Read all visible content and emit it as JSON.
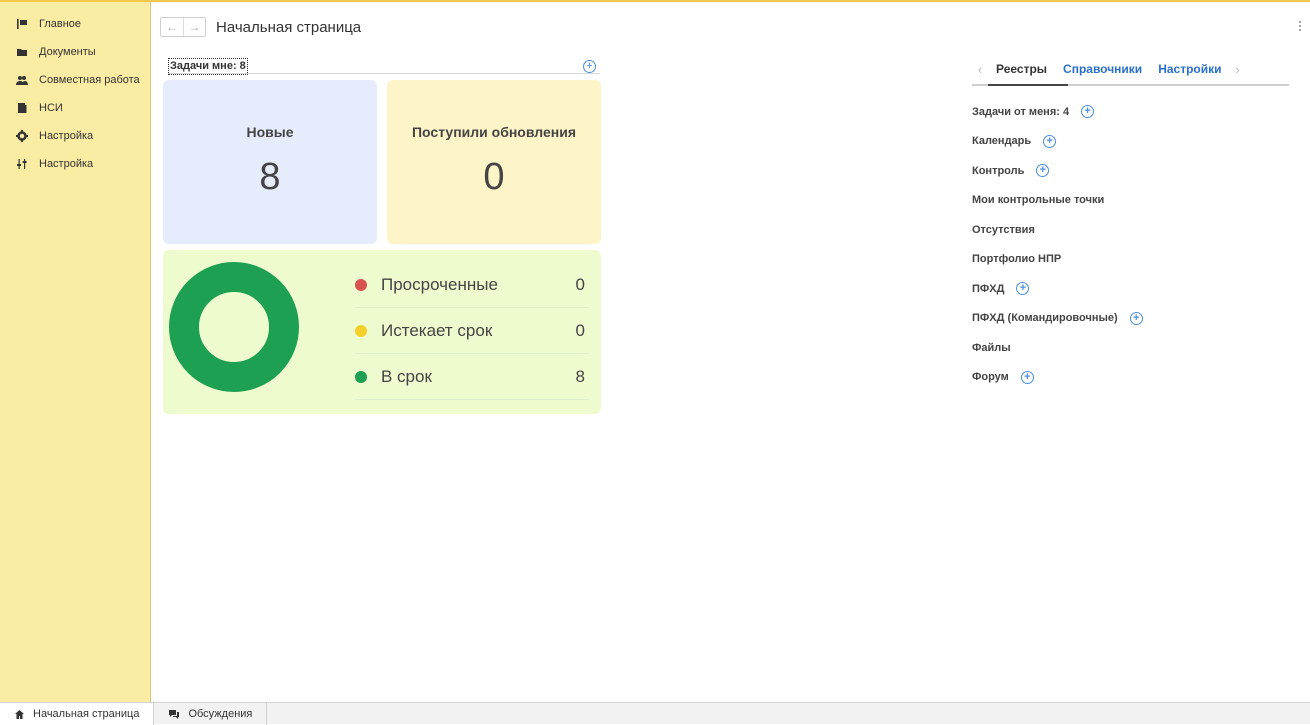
{
  "sidebar": {
    "items": [
      {
        "label": "Главное",
        "icon": "flag-icon"
      },
      {
        "label": "Документы",
        "icon": "folder-icon"
      },
      {
        "label": "Совместная работа",
        "icon": "users-icon"
      },
      {
        "label": "НСИ",
        "icon": "book-icon"
      },
      {
        "label": "Настройка",
        "icon": "gear-icon"
      },
      {
        "label": "Настройка",
        "icon": "sliders-icon"
      }
    ]
  },
  "header": {
    "title": "Начальная страница",
    "back_icon": "←",
    "forward_icon": "→"
  },
  "tasks": {
    "label": "Задачи мне: 8"
  },
  "cards": {
    "new_title": "Новые",
    "new_value": "8",
    "updates_title": "Поступили обновления",
    "updates_value": "0"
  },
  "status": {
    "rows": [
      {
        "label": "Просроченные",
        "value": "0",
        "color": "#d9534f"
      },
      {
        "label": "Истекает срок",
        "value": "0",
        "color": "#f5cf2a"
      },
      {
        "label": "В срок",
        "value": "8",
        "color": "#1ea052"
      }
    ],
    "donut_color": "#1ea052"
  },
  "tabs": {
    "items": [
      "Реестры",
      "Справочники",
      "Настройки"
    ],
    "active": "Реестры"
  },
  "links": {
    "items": [
      {
        "label": "Задачи от меня: 4",
        "plus": true
      },
      {
        "label": "Календарь",
        "plus": true
      },
      {
        "label": "Контроль",
        "plus": true
      },
      {
        "label": "Мои контрольные точки",
        "plus": false
      },
      {
        "label": "Отсутствия",
        "plus": false
      },
      {
        "label": "Портфолио НПР",
        "plus": false
      },
      {
        "label": "ПФХД",
        "plus": true
      },
      {
        "label": "ПФХД (Командировочные)",
        "plus": true
      },
      {
        "label": "Файлы",
        "plus": false
      },
      {
        "label": "Форум",
        "plus": true
      }
    ]
  },
  "footer": {
    "home_label": "Начальная страница",
    "discussions_label": "Обсуждения"
  },
  "colors": {
    "sidebar_bg": "#fbeca4",
    "link_blue": "#2a70c8"
  }
}
